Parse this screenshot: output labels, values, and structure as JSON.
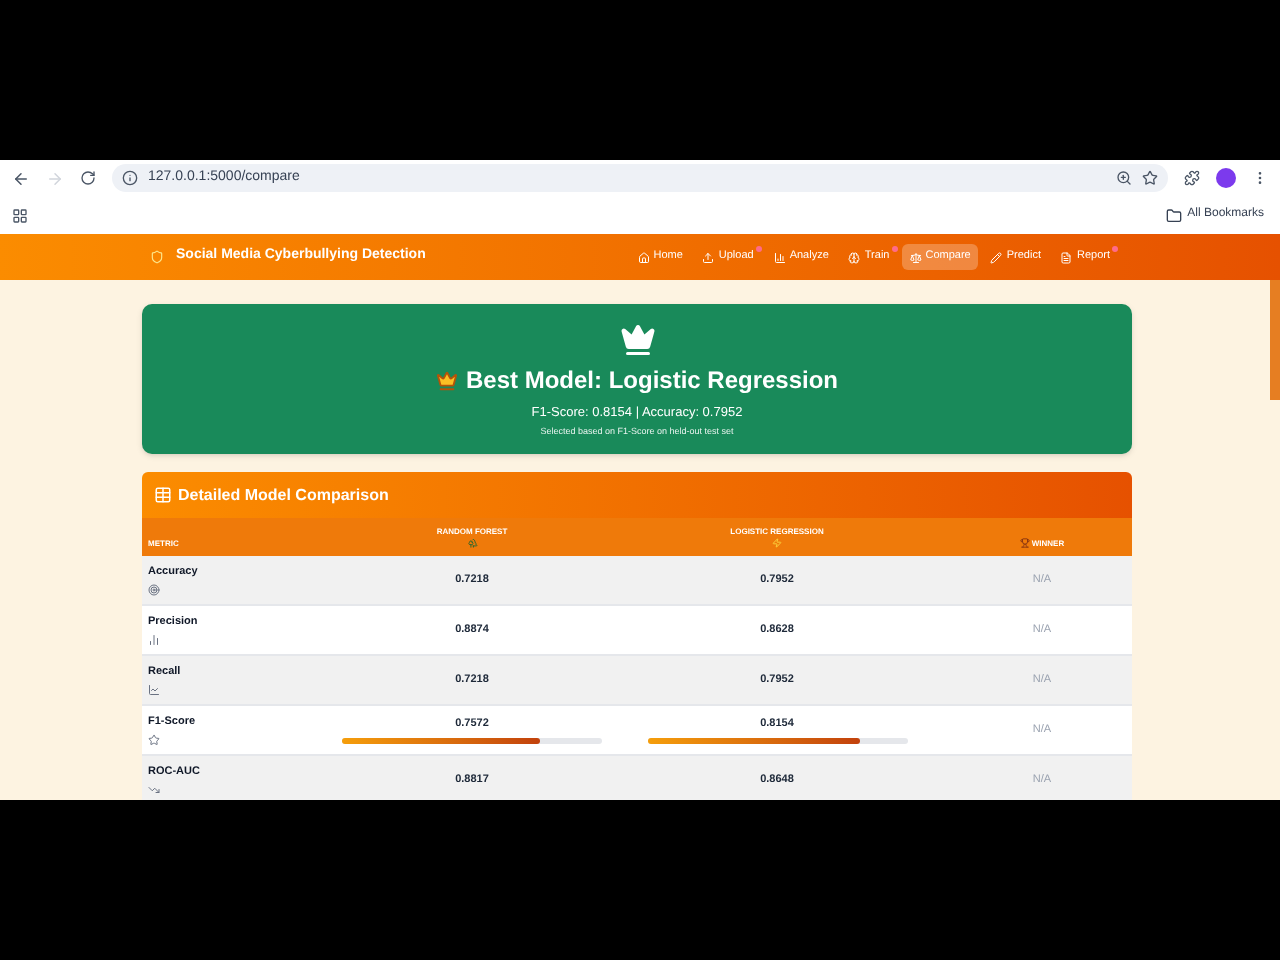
{
  "browser": {
    "url": "127.0.0.1:5000/compare",
    "bookmarks_label": "All Bookmarks"
  },
  "navbar": {
    "brand": "Social Media Cyberbullying Detection",
    "items": [
      {
        "label": "Home",
        "selected": false,
        "notification": false
      },
      {
        "label": "Upload",
        "selected": false,
        "notification": true
      },
      {
        "label": "Analyze",
        "selected": false,
        "notification": false
      },
      {
        "label": "Train",
        "selected": false,
        "notification": true
      },
      {
        "label": "Compare",
        "selected": true,
        "notification": false
      },
      {
        "label": "Predict",
        "selected": false,
        "notification": false
      },
      {
        "label": "Report",
        "selected": false,
        "notification": true
      }
    ]
  },
  "best_model": {
    "title": "Best Model: Logistic Regression",
    "scores": "F1-Score: 0.8154 | Accuracy: 0.7952",
    "note": "Selected based on F1-Score on held-out test set"
  },
  "comparison": {
    "title": "Detailed Model Comparison",
    "columns": [
      "METRIC",
      "RANDOM FOREST",
      "LOGISTIC REGRESSION",
      "WINNER"
    ],
    "rows": [
      {
        "metric": "Accuracy",
        "random_forest": "0.7218",
        "logistic_regression": "0.7952",
        "winner": "N/A"
      },
      {
        "metric": "Precision",
        "random_forest": "0.8874",
        "logistic_regression": "0.8628",
        "winner": "N/A"
      },
      {
        "metric": "Recall",
        "random_forest": "0.7218",
        "logistic_regression": "0.7952",
        "winner": "N/A"
      },
      {
        "metric": "F1-Score",
        "random_forest": "0.7572",
        "logistic_regression": "0.8154",
        "winner": "N/A",
        "random_forest_bar": {
          "level": 0.76
        },
        "logistic_regression_bar": {
          "level": 0.82
        }
      },
      {
        "metric": "ROC-AUC",
        "random_forest": "0.8817",
        "logistic_regression": "0.8648",
        "winner": "N/A"
      }
    ]
  }
}
